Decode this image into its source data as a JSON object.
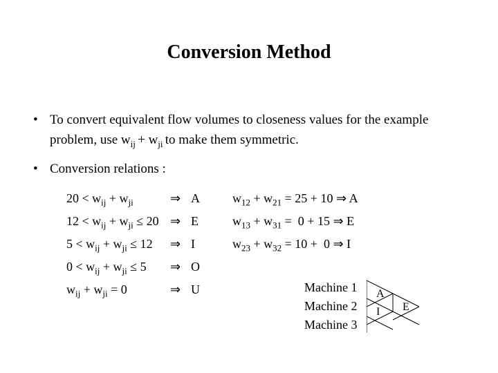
{
  "title": "Conversion Method",
  "bullets": {
    "b1_pre": "To convert equivalent flow volumes to closeness values for the example problem, use w",
    "b1_sub1": "ij ",
    "b1_mid": "+ w",
    "b1_sub2": "ji ",
    "b1_post": "to make them symmetric.",
    "b2": "Conversion relations :"
  },
  "rules": {
    "r1_cond": "20 < w",
    "r1_rest": " + w",
    "r1_sym": "A",
    "r2_cond": "12 < w",
    "r2_rest": " + w",
    "r2_end": " ≤ 20",
    "r2_sym": "E",
    "r3_cond": "5 < w",
    "r3_rest": " + w",
    "r3_end": " ≤ 12",
    "r3_sym": "I",
    "r4_cond": "0 < w",
    "r4_rest": " + w",
    "r4_end": " ≤ 5",
    "r4_sym": "O",
    "r5_cond": "w",
    "r5_rest": " + w",
    "r5_end": " = 0",
    "r5_sym": "U"
  },
  "calcs": {
    "c1_a": "w",
    "c1_b": " + w",
    "c1_val": " = 25 + 10 ",
    "c1_sym": " A",
    "c2_a": "w",
    "c2_b": " + w",
    "c2_val": " =  0 + 15 ",
    "c2_sym": " E",
    "c3_a": "w",
    "c3_b": " + w",
    "c3_val": " = 10 +  0 ",
    "c3_sym": " I"
  },
  "subs": {
    "ij": "ij",
    "ji": "ji",
    "s12": "12",
    "s21": "21",
    "s13": "13",
    "s31": "31",
    "s23": "23",
    "s32": "32"
  },
  "arrow": "⇒",
  "machines": {
    "m1": "Machine 1",
    "m2": "Machine 2",
    "m3": "Machine 3"
  },
  "rel_labels": {
    "a": "A",
    "e": "E",
    "i": "I"
  }
}
